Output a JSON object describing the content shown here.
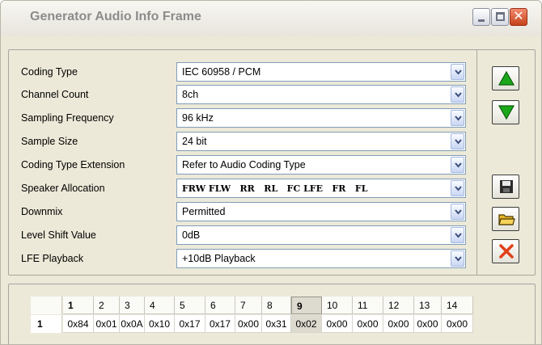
{
  "window": {
    "title": "Generator Audio Info Frame",
    "controls": [
      "minimize-icon",
      "maximize-icon",
      "close-icon"
    ]
  },
  "fields": [
    {
      "label": "Coding Type",
      "value": "IEC 60958 / PCM"
    },
    {
      "label": "Channel Count",
      "value": "8ch"
    },
    {
      "label": "Sampling Frequency",
      "value": "96 kHz"
    },
    {
      "label": "Sample Size",
      "value": "24 bit"
    },
    {
      "label": "Coding Type Extension",
      "value": "Refer to Audio Coding Type"
    },
    {
      "label": "Speaker Allocation",
      "value": "FRW FLW   RR   RL   FC LFE   FR   FL"
    },
    {
      "label": "Downmix",
      "value": "Permitted"
    },
    {
      "label": "Level Shift Value",
      "value": "0dB"
    },
    {
      "label": "LFE Playback",
      "value": "+10dB Playback"
    }
  ],
  "side_buttons": [
    {
      "icon": "arrow-up-icon",
      "color": "#1aa81a"
    },
    {
      "icon": "arrow-down-icon",
      "color": "#1aa81a"
    },
    {
      "icon": "save-icon"
    },
    {
      "icon": "open-folder-icon"
    },
    {
      "icon": "delete-icon",
      "color": "#e0401a"
    }
  ],
  "byte_table": {
    "columns": [
      "1",
      "2",
      "3",
      "4",
      "5",
      "6",
      "7",
      "8",
      "9",
      "10",
      "11",
      "12",
      "13",
      "14"
    ],
    "selected_column": "9",
    "rows": [
      {
        "label": "1",
        "cells": [
          "0x84",
          "0x01",
          "0x0A",
          "0x10",
          "0x17",
          "0x17",
          "0x00",
          "0x31",
          "0x02",
          "0x00",
          "0x00",
          "0x00",
          "0x00",
          "0x00"
        ]
      }
    ]
  }
}
